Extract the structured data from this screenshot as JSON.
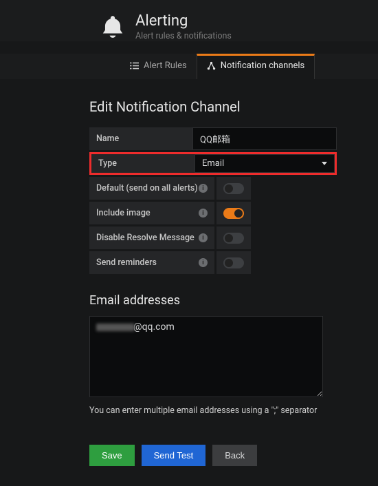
{
  "header": {
    "title": "Alerting",
    "subtitle": "Alert rules & notifications"
  },
  "tabs": {
    "alert_rules": "Alert Rules",
    "notification_channels": "Notification channels"
  },
  "page_title": "Edit Notification Channel",
  "form": {
    "name_label": "Name",
    "name_value": "QQ邮箱",
    "type_label": "Type",
    "type_value": "Email",
    "default_label": "Default (send on all alerts)",
    "default_on": false,
    "include_image_label": "Include image",
    "include_image_on": true,
    "disable_resolve_label": "Disable Resolve Message",
    "disable_resolve_on": false,
    "send_reminders_label": "Send reminders",
    "send_reminders_on": false
  },
  "email": {
    "section_title": "Email addresses",
    "value_suffix": "@qq.com",
    "hint": "You can enter multiple email addresses using a \";\" separator"
  },
  "buttons": {
    "save": "Save",
    "test": "Send Test",
    "back": "Back"
  }
}
